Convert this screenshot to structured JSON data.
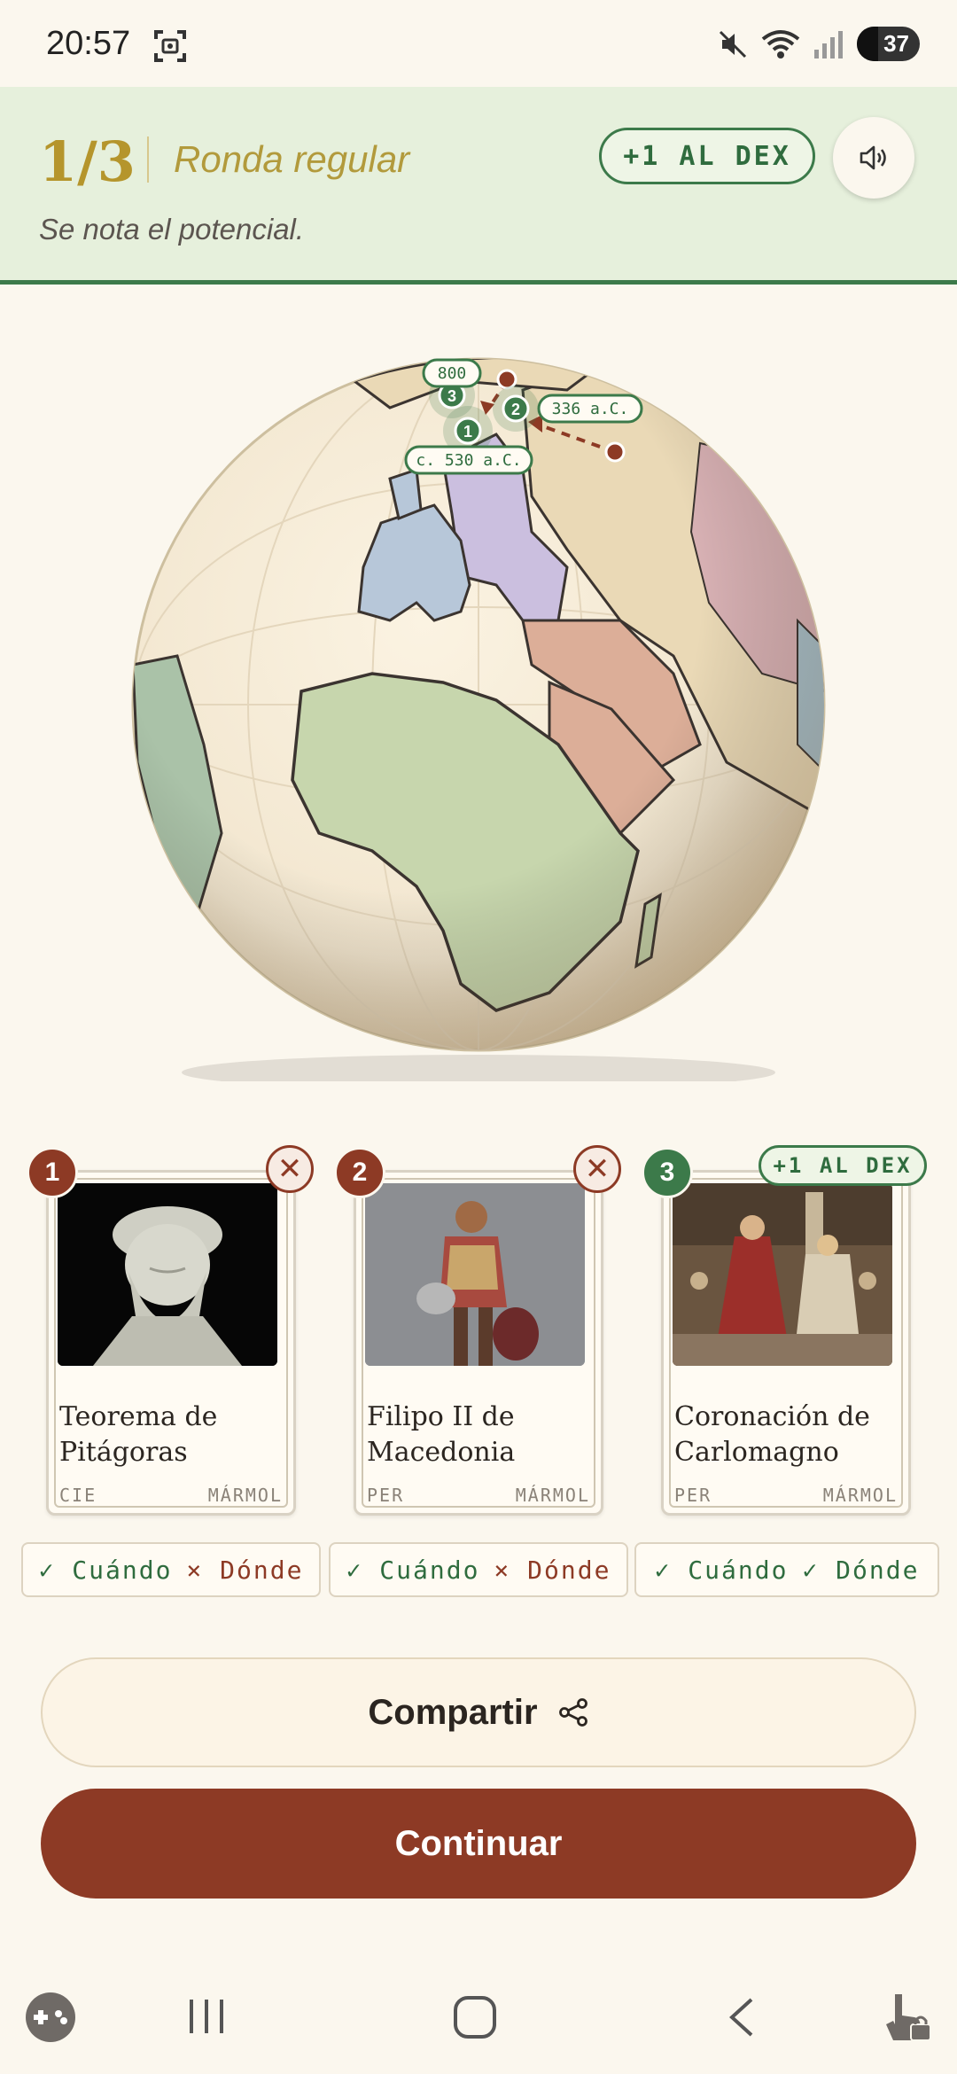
{
  "status_bar": {
    "time": "20:57",
    "battery": "37"
  },
  "header": {
    "round_count": "1/3",
    "round_type": "Ronda regular",
    "subtitle": "Se nota el potencial.",
    "dex_button": "+1 AL DEX",
    "sound_icon": "speaker-icon"
  },
  "map": {
    "labels": [
      {
        "id": "1",
        "text": "c. 530 a.C."
      },
      {
        "id": "2",
        "text": "336 a.C."
      },
      {
        "id": "3",
        "text": "800"
      }
    ]
  },
  "cards": [
    {
      "number": "1",
      "title_line1": "Teorema de",
      "title_line2": "Pitágoras",
      "category": "CIE",
      "rarity": "MÁRMOL",
      "status": "wrong",
      "when": "Cuándo",
      "where": "Dónde",
      "when_ok": true,
      "where_ok": false
    },
    {
      "number": "2",
      "title_line1": "Filipo II de",
      "title_line2": "Macedonia",
      "category": "PER",
      "rarity": "MÁRMOL",
      "status": "wrong",
      "when": "Cuándo",
      "where": "Dónde",
      "when_ok": true,
      "where_ok": false
    },
    {
      "number": "3",
      "title_line1": "Coronación de",
      "title_line2": "Carlomagno",
      "category": "PER",
      "rarity": "MÁRMOL",
      "status": "correct",
      "when": "Cuándo",
      "where": "Dónde",
      "when_ok": true,
      "where_ok": true,
      "dex_tag": "+1 AL DEX"
    }
  ],
  "results": {
    "r1_when": "✓ Cuándo",
    "r1_where": "× Dónde",
    "r2_when": "✓ Cuándo",
    "r2_where": "× Dónde",
    "r3_when": "✓ Cuándo",
    "r3_where": "✓ Dónde"
  },
  "actions": {
    "share": "Compartir",
    "continue": "Continuar"
  },
  "colors": {
    "accent_red": "#8d3a25",
    "accent_green": "#3c7a4a",
    "gold": "#b5952c",
    "header_bg": "#e6f0dc",
    "page_bg": "#fbf7ee"
  }
}
